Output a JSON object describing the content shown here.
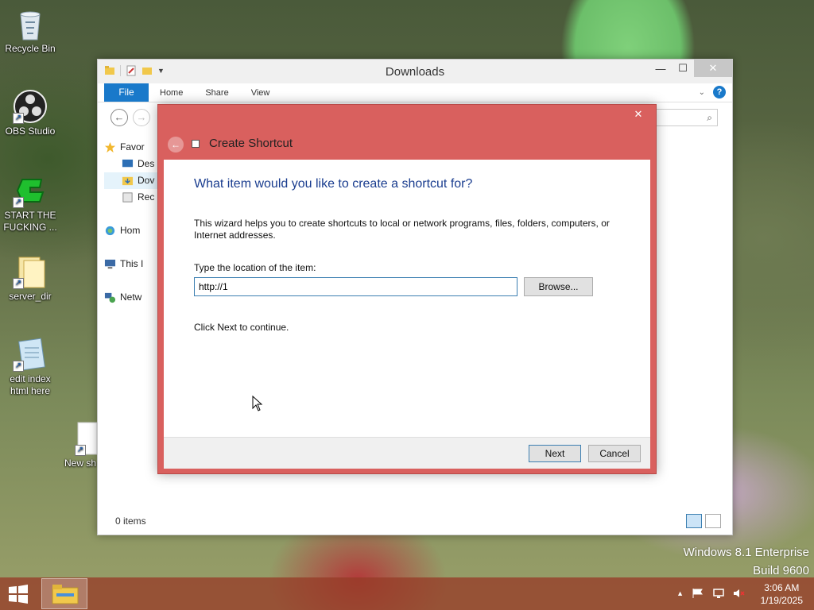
{
  "desktop": {
    "icons": [
      {
        "label": "Recycle Bin",
        "icon": "recycle-bin-icon"
      },
      {
        "label": "OBS Studio",
        "icon": "obs-icon"
      },
      {
        "label": "START THE FUCKING ...",
        "icon": "green-g-icon"
      },
      {
        "label": "server_dir",
        "icon": "folder-icon"
      },
      {
        "label": "edit index html here",
        "icon": "notepad-icon"
      },
      {
        "label": "New sh",
        "icon": "blank-file-icon"
      }
    ]
  },
  "explorer": {
    "title": "Downloads",
    "ribbon": {
      "file": "File",
      "tabs": [
        "Home",
        "Share",
        "View"
      ],
      "help": "?"
    },
    "nav": {
      "favorites": "Favor",
      "desktop": "Des",
      "downloads": "Dov",
      "recent": "Rec",
      "homegroup": "Hom",
      "this_pc": "This I",
      "network": "Netw"
    },
    "status": "0 items",
    "search_glyph": "⌕"
  },
  "dialog": {
    "title": "Create Shortcut",
    "heading": "What item would you like to create a shortcut for?",
    "description": "This wizard helps you to create shortcuts to local or network programs, files, folders, computers, or Internet addresses.",
    "location_label": "Type the location of the item:",
    "location_value": "http://1",
    "browse": "Browse...",
    "hint": "Click Next to continue.",
    "next": "Next",
    "cancel": "Cancel",
    "close": "✕"
  },
  "watermark": {
    "line1": "Windows 8.1 Enterprise",
    "line2": "Build 9600"
  },
  "taskbar": {
    "time": "3:06 AM",
    "date": "1/19/2025"
  },
  "colors": {
    "dialog_frame": "#d9605e",
    "heading": "#1a3d8f",
    "file_tab": "#1979ca",
    "taskbar": "#963c28"
  }
}
